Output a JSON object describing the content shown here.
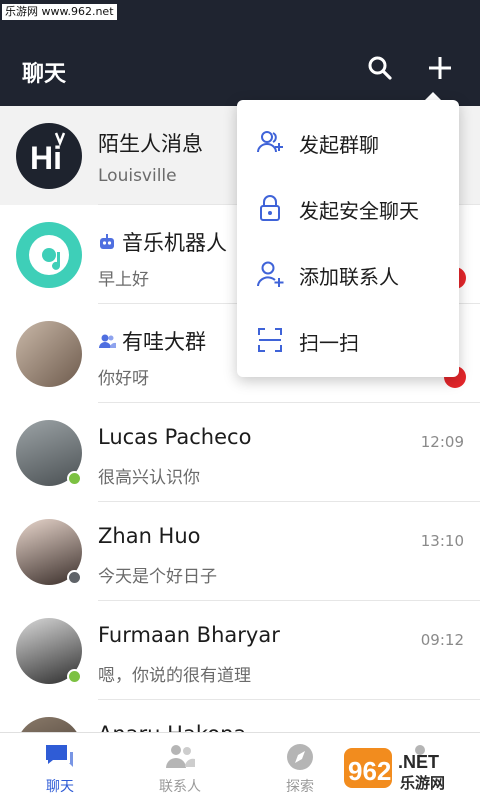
{
  "watermark_top": "乐游网 www.962.net",
  "header": {
    "title": "聊天"
  },
  "chats": [
    {
      "name": "陌生人消息",
      "preview": "Louisville",
      "time": "",
      "online": "",
      "unread": false,
      "avatar": "hi-logo",
      "name_icon": ""
    },
    {
      "name": "音乐机器人",
      "preview": "早上好",
      "time": "",
      "online": "",
      "unread": true,
      "avatar": "music-disc",
      "name_icon": "robot-icon"
    },
    {
      "name": "有哇大群",
      "preview": "你好呀",
      "time": "",
      "online": "",
      "unread": true,
      "avatar": "photo",
      "name_icon": "group-icon"
    },
    {
      "name": "Lucas Pacheco",
      "preview": "很高兴认识你",
      "time": "12:09",
      "online": "online",
      "unread": false,
      "avatar": "photo"
    },
    {
      "name": "Zhan Huo",
      "preview": "今天是个好日子",
      "time": "13:10",
      "online": "offline",
      "unread": false,
      "avatar": "photo"
    },
    {
      "name": "Furmaan Bharyar",
      "preview": "嗯，你说的很有道理",
      "time": "09:12",
      "online": "online",
      "unread": false,
      "avatar": "photo"
    },
    {
      "name": "Anaru Hakopa",
      "preview": "",
      "time": "",
      "online": "",
      "unread": false,
      "avatar": "photo"
    }
  ],
  "menu": [
    {
      "label": "发起群聊",
      "icon": "group-add-icon"
    },
    {
      "label": "发起安全聊天",
      "icon": "lock-icon"
    },
    {
      "label": "添加联系人",
      "icon": "person-add-icon"
    },
    {
      "label": "扫一扫",
      "icon": "scan-icon"
    }
  ],
  "nav": [
    {
      "label": "聊天",
      "icon": "chat-icon",
      "active": true
    },
    {
      "label": "联系人",
      "icon": "contacts-icon",
      "active": false
    },
    {
      "label": "探索",
      "icon": "compass-icon",
      "active": false
    },
    {
      "label": "",
      "icon": "me-icon",
      "active": false
    }
  ],
  "watermark_bottom": {
    "brand": "962",
    "suffix": ".NET",
    "sub": "乐游网"
  },
  "colors": {
    "header_bg": "#1f2430",
    "accent": "#2f5cd6",
    "online": "#7cc142",
    "offline": "#5f6368",
    "unread": "#e5262b",
    "music_teal": "#3ecfb8"
  }
}
